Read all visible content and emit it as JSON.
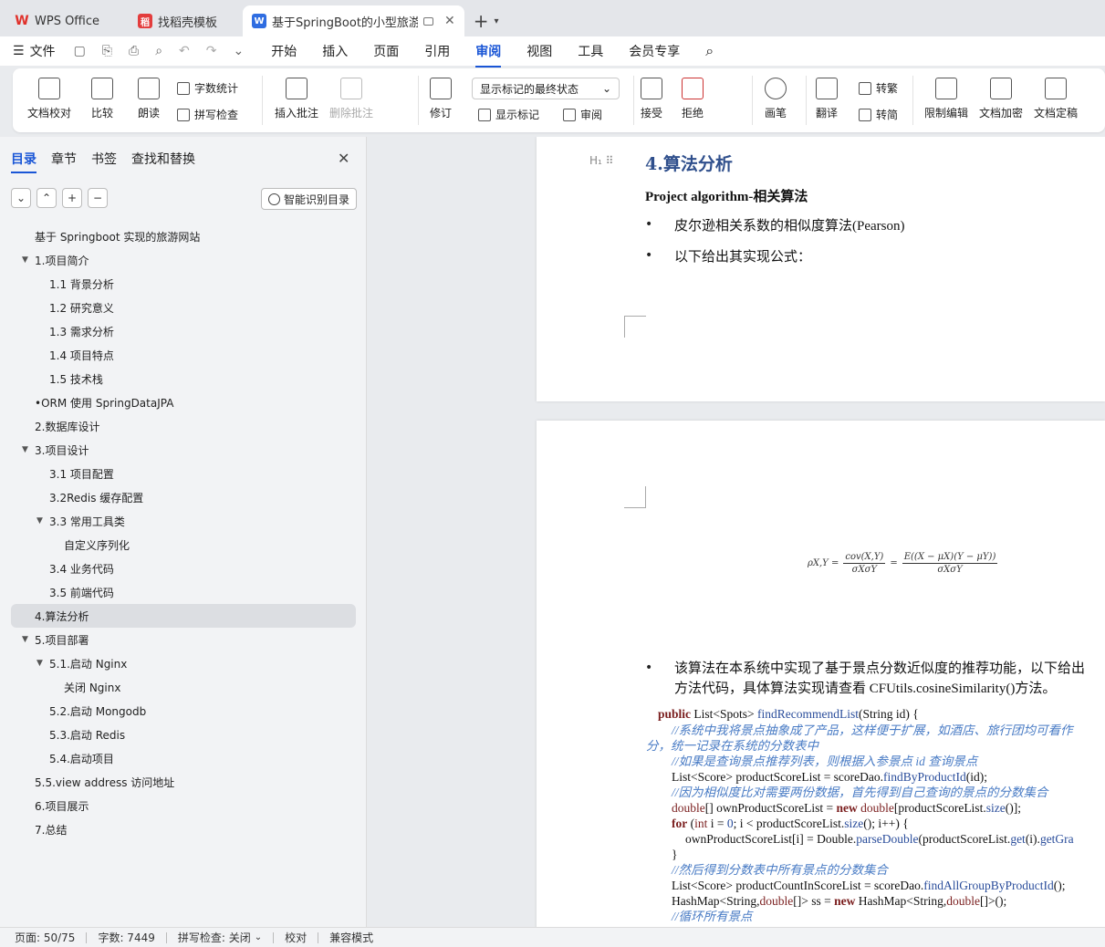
{
  "tabs": [
    {
      "label": "WPS Office",
      "icon": "wps-logo-icon",
      "color": "#e0312b"
    },
    {
      "label": "找稻壳模板",
      "icon": "docer-logo-icon",
      "color": "#e33d3d"
    },
    {
      "label": "基于SpringBoot的小型旅游",
      "icon": "word-doc-icon",
      "color": "#2f6de1",
      "close": "✕"
    }
  ],
  "tabbar": {
    "add_icon": "+",
    "add_chevron": "▾"
  },
  "menu": {
    "file_icon": "☰",
    "file_label": "文件",
    "items": [
      "开始",
      "插入",
      "页面",
      "引用",
      "审阅",
      "视图",
      "工具",
      "会员专享"
    ],
    "active": "审阅",
    "search_icon": "⌕"
  },
  "ribbon": {
    "doc_check": "文档校对",
    "compare": "比较",
    "read_aloud": "朗读",
    "word_count": "字数统计",
    "spell_check": "拼写检查",
    "insert_comment": "插入批注",
    "delete_comment": "删除批注",
    "track_changes": "修订",
    "markup_select": "显示标记的最终状态",
    "show_markup": "显示标记",
    "review": "审阅",
    "accept": "接受",
    "reject": "拒绝",
    "brush": "画笔",
    "translate": "翻译",
    "to_traditional": "转繁",
    "to_simplified": "转简",
    "restrict_edit": "限制编辑",
    "encrypt": "文档加密",
    "finalize": "文档定稿",
    "accent": "#1a56d6"
  },
  "sidebar": {
    "tabs": [
      "目录",
      "章节",
      "书签",
      "查找和替换"
    ],
    "active_tab": "目录",
    "close": "✕",
    "smart_toc": "智能识别目录",
    "toc": [
      {
        "label": "基于 Springboot 实现的旅游网站",
        "level": 1,
        "arrow": ""
      },
      {
        "label": "1.项目简介",
        "level": 1,
        "arrow": "▼"
      },
      {
        "label": "1.1 背景分析",
        "level": 2,
        "arrow": ""
      },
      {
        "label": "1.2 研究意义",
        "level": 2,
        "arrow": ""
      },
      {
        "label": "1.3 需求分析",
        "level": 2,
        "arrow": ""
      },
      {
        "label": "1.4 项目特点",
        "level": 2,
        "arrow": ""
      },
      {
        "label": "1.5 技术栈",
        "level": 2,
        "arrow": ""
      },
      {
        "label": "•ORM 使用 SpringDataJPA",
        "level": 1,
        "arrow": ""
      },
      {
        "label": "2.数据库设计",
        "level": 1,
        "arrow": ""
      },
      {
        "label": "3.项目设计",
        "level": 1,
        "arrow": "▼"
      },
      {
        "label": "3.1 项目配置",
        "level": 2,
        "arrow": ""
      },
      {
        "label": "3.2Redis 缓存配置",
        "level": 2,
        "arrow": ""
      },
      {
        "label": "3.3 常用工具类",
        "level": 2,
        "arrow": "▼"
      },
      {
        "label": "自定义序列化",
        "level": 3,
        "arrow": ""
      },
      {
        "label": "3.4 业务代码",
        "level": 2,
        "arrow": ""
      },
      {
        "label": "3.5 前端代码",
        "level": 2,
        "arrow": ""
      },
      {
        "label": "4.算法分析",
        "level": 1,
        "arrow": "",
        "selected": true
      },
      {
        "label": "5.项目部署",
        "level": 1,
        "arrow": "▼"
      },
      {
        "label": "5.1.启动 Nginx",
        "level": 2,
        "arrow": "▼"
      },
      {
        "label": "关闭 Nginx",
        "level": 3,
        "arrow": ""
      },
      {
        "label": "5.2.启动 Mongodb",
        "level": 2,
        "arrow": ""
      },
      {
        "label": "5.3.启动 Redis",
        "level": 2,
        "arrow": ""
      },
      {
        "label": "5.4.启动项目",
        "level": 2,
        "arrow": ""
      },
      {
        "label": "5.5.view address 访问地址",
        "level": 1,
        "arrow": ""
      },
      {
        "label": "6.项目展示",
        "level": 1,
        "arrow": ""
      },
      {
        "label": "7.总结",
        "level": 1,
        "arrow": ""
      }
    ]
  },
  "document": {
    "heading_marker": "H₁ ⠿",
    "heading": "4.算法分析",
    "sub": "Project algorithm-相关算法",
    "bullet1": "皮尔逊相关系数的相似度算法(Pearson)",
    "bullet2": "以下给出其实现公式：",
    "formula": {
      "lhs": "ρX,Y =",
      "n1": "cov(X,Y)",
      "d1": "σXσY",
      "eq": "=",
      "n2": "E((X − μX)(Y − μY))",
      "d2": "σXσY"
    },
    "bullet3a": "该算法在本系统中实现了基于景点分数近似度的推荐功能，以下给出",
    "bullet3b": "方法代码，具体算法实现请查看 CFUtils.cosineSimilarity()方法。",
    "bullet_char": "•"
  },
  "status": {
    "page": "页面: 50/75",
    "words": "字数: 7449",
    "spell": "拼写检查: 关闭",
    "proof": "校对",
    "compat": "兼容模式"
  }
}
